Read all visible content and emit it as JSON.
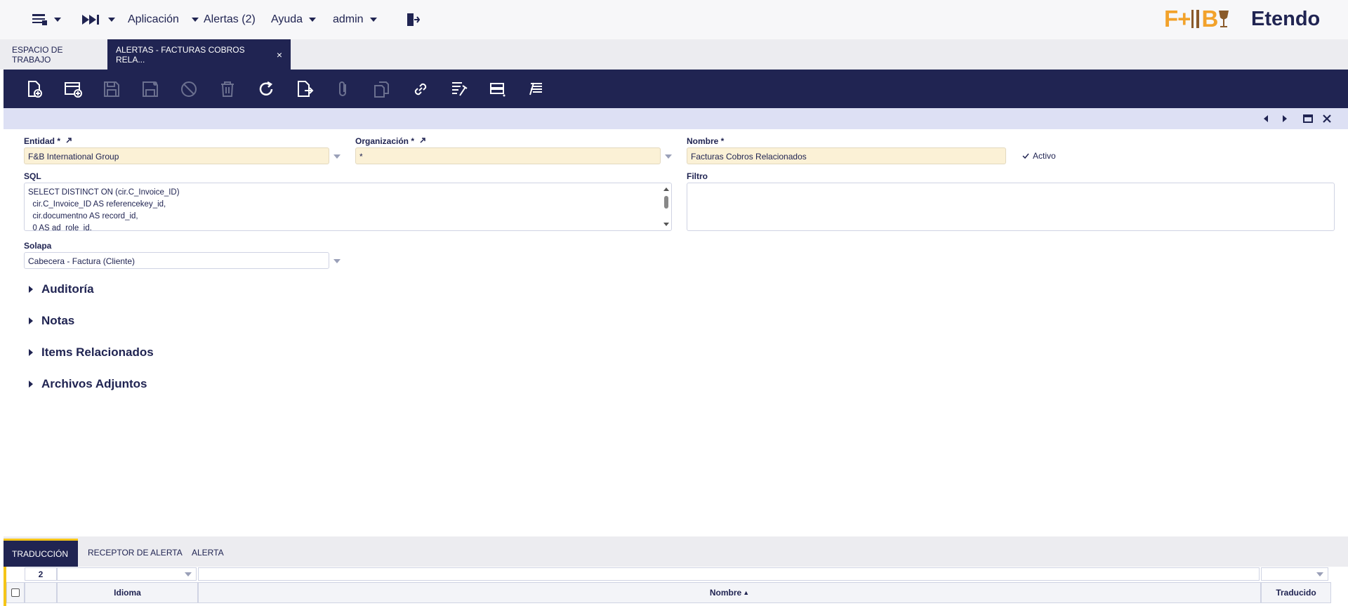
{
  "topbar": {
    "menu_icon": "list-icon",
    "quicklaunch_icon": "fast-forward-icon",
    "app_menu": "Aplicación",
    "alerts": "Alertas (2)",
    "help": "Ayuda",
    "user": "admin",
    "logout_icon": "logout-icon",
    "logo_fb_left": "F+",
    "logo_fb_mid": "B",
    "logo_etendo": "Etendo"
  },
  "tabs": [
    {
      "label": "ESPACIO DE TRABAJO",
      "active": false
    },
    {
      "label": "ALERTAS - FACTURAS COBROS RELA...",
      "active": true
    }
  ],
  "tab_close": "×",
  "toolbar": {
    "buttons": [
      "new-document-icon",
      "new-row-icon",
      "save-icon",
      "save-close-icon",
      "cancel-icon",
      "delete-icon",
      "refresh-icon",
      "export-icon",
      "attachment-icon",
      "clone-icon",
      "link-icon",
      "audit-icon",
      "grid-view-icon",
      "notes-icon"
    ]
  },
  "form": {
    "entidad_label": "Entidad *",
    "entidad_value": "F&B International Group",
    "org_label": "Organización *",
    "org_value": "*",
    "nombre_label": "Nombre *",
    "nombre_value": "Facturas Cobros Relacionados",
    "activo_label": "Activo",
    "sql_label": "SQL",
    "sql_lines": [
      "SELECT DISTINCT ON (cir.C_Invoice_ID)",
      "  cir.C_Invoice_ID AS referencekey_id,",
      "  cir.documentno AS record_id,",
      "  0 AS ad_role_id,"
    ],
    "filtro_label": "Filtro",
    "filtro_value": "",
    "solapa_label": "Solapa",
    "solapa_value": "Cabecera - Factura (Cliente)"
  },
  "sections": [
    "Auditoría",
    "Notas",
    "Items Relacionados",
    "Archivos Adjuntos"
  ],
  "bottom_tabs": [
    {
      "label": "TRADUCCIÓN",
      "active": true
    },
    {
      "label": "RECEPTOR DE ALERTA",
      "active": false
    },
    {
      "label": "ALERTA",
      "active": false
    }
  ],
  "grid": {
    "count": "2",
    "columns": [
      "Idioma",
      "Nombre",
      "Traducido"
    ],
    "sort_indicator": "▲"
  }
}
